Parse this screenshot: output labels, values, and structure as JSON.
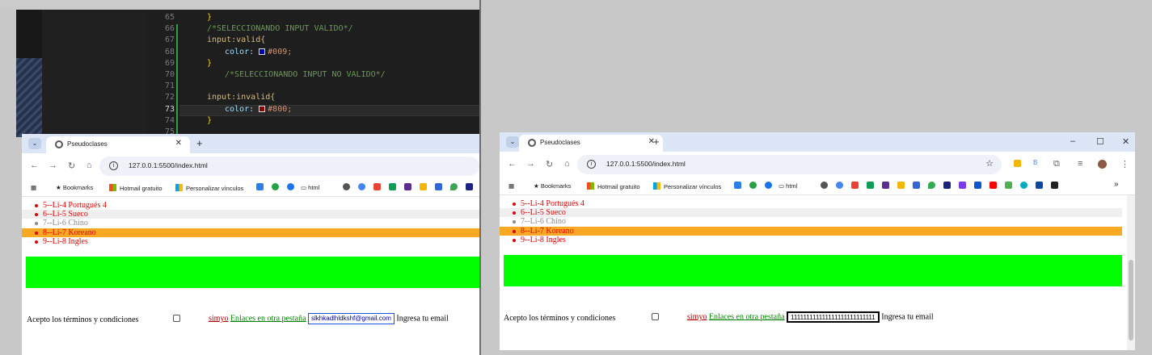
{
  "editor": {
    "lines": [
      {
        "num": "65",
        "text": "}",
        "cls": "c-brace",
        "indent": 0
      },
      {
        "num": "66",
        "text": "/*SELECCIONANDO INPUT VALIDO*/",
        "cls": "c-comment",
        "indent": 0
      },
      {
        "num": "67",
        "text": "input:valid{",
        "cls": "c-sel",
        "indent": 0
      },
      {
        "num": "68",
        "prop": "color:",
        "value": "#009;",
        "swatch": "#0000aa",
        "indent": 1
      },
      {
        "num": "69",
        "text": "}",
        "cls": "c-brace",
        "indent": 0
      },
      {
        "num": "70",
        "text": "/*SELECCIONANDO INPUT NO VALIDO*/",
        "cls": "c-comment",
        "indent": 1
      },
      {
        "num": "71",
        "text": "",
        "cls": "c-punc",
        "indent": 0
      },
      {
        "num": "72",
        "text": "input:invalid{",
        "cls": "c-sel",
        "indent": 0
      },
      {
        "num": "73",
        "prop": "color:",
        "value": "#800;",
        "swatch": "#880000",
        "indent": 1
      },
      {
        "num": "74",
        "text": "}",
        "cls": "c-brace",
        "indent": 0
      },
      {
        "num": "75",
        "text": "",
        "cls": "c-punc",
        "indent": 0
      }
    ],
    "current_line": "73"
  },
  "left_browser": {
    "tab_title": "Pseudoclases",
    "url": "127.0.0.1:5500/index.html",
    "bookmarks": {
      "bookmarks": "Bookmarks",
      "hotmail": "Hotmail gratuito",
      "personalizar": "Personalizar vínculos",
      "html": "html"
    },
    "list": [
      "5--Li-4 Portugués 4",
      "6--Li-5 Sueco",
      "7--Li-6 Chino",
      "8--Li-7 Koreano",
      "9--Li-8 Ingles"
    ],
    "form": {
      "terms": "Acepto los términos y condiciones",
      "link1": "simyo",
      "link2": "Enlaces en otra pestaña",
      "email_value": "slkhkadlhldkshf@gmail.com",
      "email_after": "Ingresa tu email"
    }
  },
  "right_browser": {
    "tab_title": "Pseudoclases",
    "url": "127.0.0.1:5500/index.html",
    "bookmarks": {
      "bookmarks": "Bookmarks",
      "hotmail": "Hotmail gratuito",
      "personalizar": "Personalizar vínculos",
      "html": "html"
    },
    "list": [
      "5--Li-4 Portugués 4",
      "6--Li-5 Sueco",
      "7--Li-6 Chino",
      "8--Li-7 Koreano",
      "9--Li-8 Ingles"
    ],
    "form": {
      "terms": "Acepto los términos y condiciones",
      "link1": "simyo",
      "link2": "Enlaces en otra pestaña",
      "email_value": "111111111111111111111111111",
      "email_after": "Ingresa tu email"
    }
  },
  "colors": {
    "green_box": "#00ff00",
    "orange_row": "#f9a824",
    "list_red": "#e00000",
    "valid_color": "#000099",
    "invalid_color": "#880000"
  }
}
